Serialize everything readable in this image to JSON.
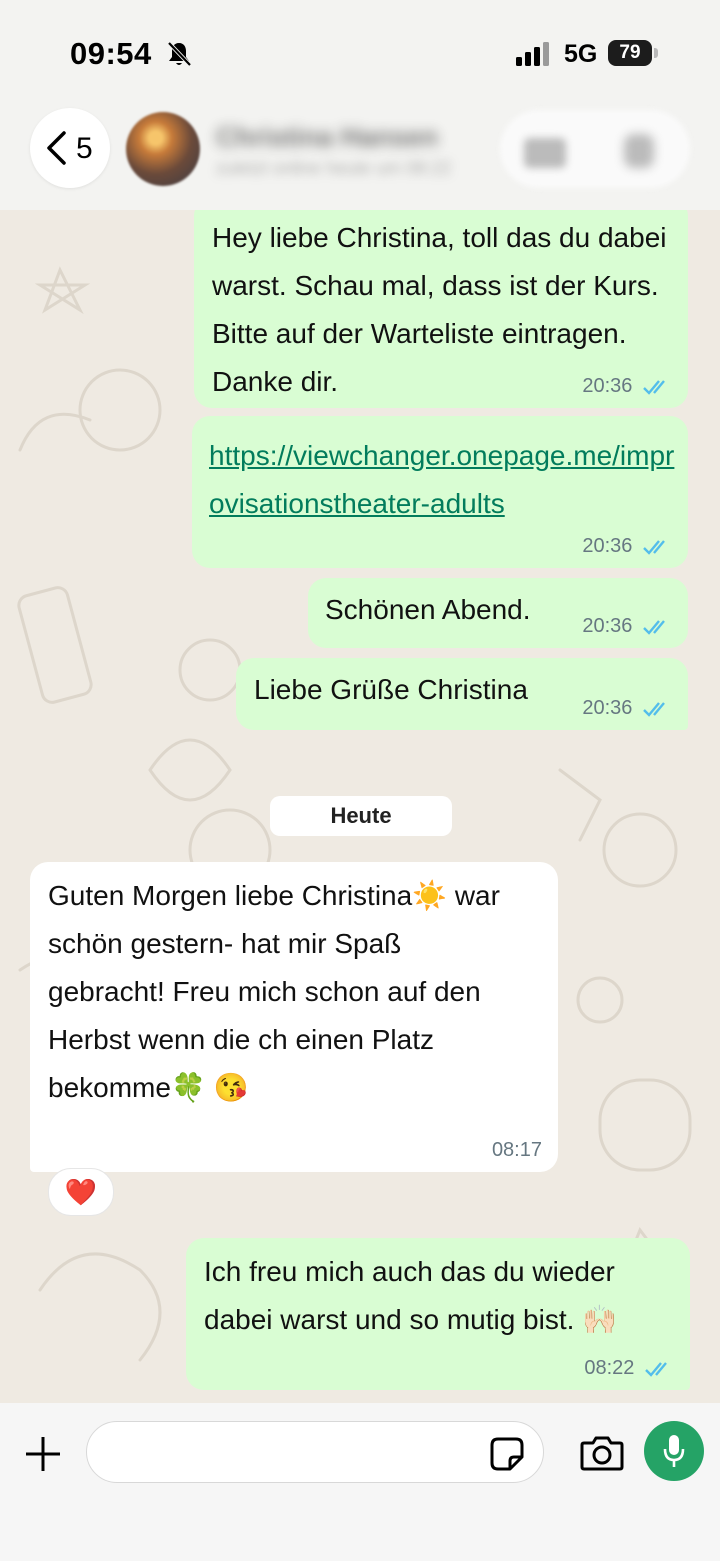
{
  "status_bar": {
    "time": "09:54",
    "network": "5G",
    "battery": "79"
  },
  "header": {
    "back_count": "5",
    "contact_name": "Christina Hansen",
    "contact_subtitle": "zuletzt online heute um 08:22"
  },
  "messages": [
    {
      "direction": "outgoing",
      "text": "Hey liebe Christina, toll das du dabei warst. Schau mal, dass ist der Kurs. Bitte auf der Warteliste eintragen. Danke dir.",
      "time": "20:36",
      "status": "read"
    },
    {
      "direction": "outgoing",
      "link": "https://viewchanger.onepage.me/improvisationstheater-adults",
      "time": "20:36",
      "status": "read"
    },
    {
      "direction": "outgoing",
      "text": "Schönen Abend.",
      "time": "20:36",
      "status": "read"
    },
    {
      "direction": "outgoing",
      "text": "Liebe Grüße Christina",
      "time": "20:36",
      "status": "read"
    },
    {
      "direction": "incoming",
      "text": "Guten Morgen liebe Christina☀️ war schön gestern- hat mir Spaß gebracht! Freu mich schon auf den Herbst wenn die ch einen Platz bekomme🍀 😘",
      "time": "08:17",
      "reaction": "❤️"
    },
    {
      "direction": "outgoing",
      "text": "Ich freu mich auch das du wieder dabei warst und so mutig bist. 🙌🏻",
      "time": "08:22",
      "status": "read"
    }
  ],
  "date_separator": "Heute",
  "input": {
    "placeholder": "",
    "value": ""
  },
  "colors": {
    "outgoing_bubble": "#d9fdd3",
    "incoming_bubble": "#ffffff",
    "link": "#027c5c",
    "read_ticks": "#53bdeb",
    "mic_button": "#25a366",
    "chat_background": "#efeae2"
  },
  "icons": [
    "bell-slash-icon",
    "signal-icon",
    "back-chevron-icon",
    "video-call-icon",
    "voice-call-icon",
    "double-check-icon",
    "plus-icon",
    "sticker-icon",
    "camera-icon",
    "microphone-icon"
  ]
}
